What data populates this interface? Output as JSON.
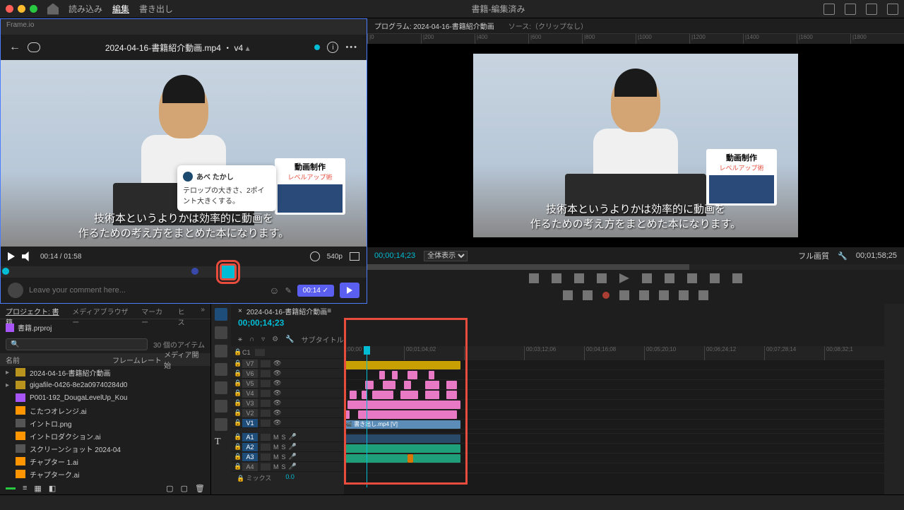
{
  "topbar": {
    "title": "書籍-編集済み",
    "menu": [
      "読み込み",
      "編集",
      "書き出し"
    ]
  },
  "frameio": {
    "header": "Frame.io",
    "title": "2024-04-16-書籍紹介動画.mp4 ・ v4",
    "subtitle_line1": "技術本というよりかは効率的に動画を",
    "subtitle_line2": "作るための考え方をまとめた本になります。",
    "book_title": "動画制作",
    "book_sub": "レベルアップ術",
    "comment_author": "あべ たかし",
    "comment_text": "テロップの大きさ、2ポイント大きくする。",
    "time": "00:14 / 01:58",
    "res": "540p",
    "comment_placeholder": "Leave your comment here...",
    "timecode": "00:14"
  },
  "program": {
    "tab1": "プログラム: 2024-04-16-書籍紹介動画",
    "tab2": "ソース:（クリップなし）",
    "timecode": "00;00;14;23",
    "fit": "全体表示",
    "quality": "フル画質",
    "duration": "00;01;58;25"
  },
  "project": {
    "tabs": [
      "プロジェクト: 書籍",
      "メディアブラウザー",
      "マーカー",
      "ヒス"
    ],
    "name": "書籍.prproj",
    "count": "30 個のアイテム",
    "cols": [
      "名前",
      "フレームレート",
      "メディア開始"
    ],
    "items": [
      {
        "icon": "bin",
        "exp": "▸",
        "name": "2024-04-16-書籍紹介動画"
      },
      {
        "icon": "bin",
        "exp": "▸",
        "name": "gigafile-0426-8e2a09740284d0"
      },
      {
        "icon": "seq",
        "exp": "",
        "name": "P001-192_DougaLevelUp_Kou"
      },
      {
        "icon": "ai",
        "exp": "",
        "name": "こたつオレンジ.ai"
      },
      {
        "icon": "img",
        "exp": "",
        "name": "イントロ.png"
      },
      {
        "icon": "ai",
        "exp": "",
        "name": "イントロダクション.ai"
      },
      {
        "icon": "img",
        "exp": "",
        "name": "スクリーンショット 2024-04"
      },
      {
        "icon": "ai",
        "exp": "",
        "name": "チャプター 1.ai"
      },
      {
        "icon": "ai",
        "exp": "",
        "name": "チャプターク.ai"
      }
    ]
  },
  "timeline": {
    "name": "2024-04-16-書籍紹介動画",
    "timecode": "00;00;14;23",
    "subtitle_label": "サブタイトル",
    "mix": "ミックス",
    "mix_val": "0.0",
    "ticks": [
      ";00;00",
      "00;01;04;02",
      "",
      "00;03;12;06",
      "00;04;16;08",
      "00;05;20;10",
      "00;06;24;12",
      "00;07;28;14",
      "00;08;32;1"
    ],
    "vtracks": [
      "V7",
      "V6",
      "V5",
      "V4",
      "V3",
      "V2",
      "V1"
    ],
    "atracks": [
      "A1",
      "A2",
      "A3",
      "A4"
    ],
    "clip_label": "書き出し.mp4 [V]"
  }
}
